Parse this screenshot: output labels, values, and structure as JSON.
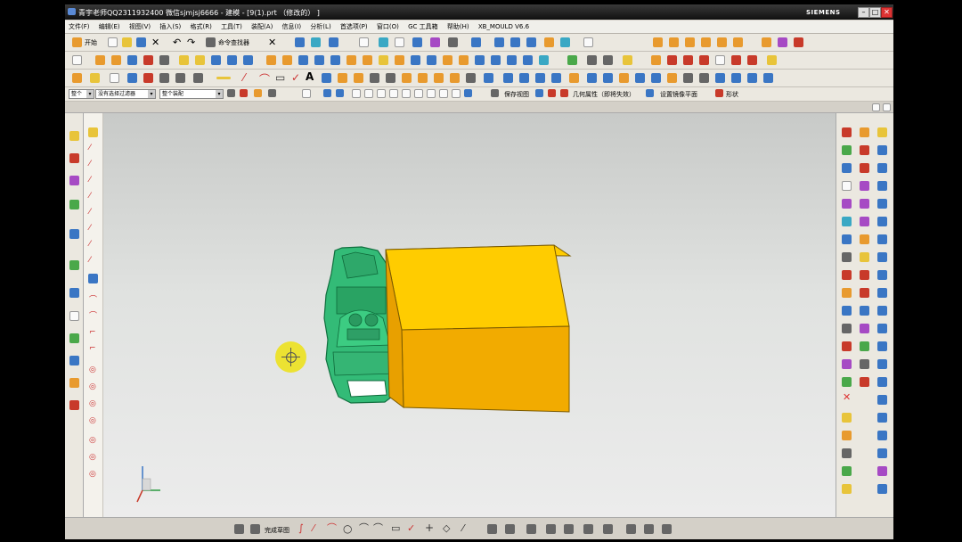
{
  "window": {
    "title": "青宇老师QQ2311932400 微信sjmjsj6666 - 建模 - [9(1).prt （修改的） ]",
    "brand": "SIEMENS",
    "buttons": {
      "minimize": "–",
      "restore": "□",
      "close": "✕"
    }
  },
  "menu": [
    "文件(F)",
    "编辑(E)",
    "视图(V)",
    "插入(S)",
    "格式(R)",
    "工具(T)",
    "装配(A)",
    "信息(I)",
    "分析(L)",
    "首选项(P)",
    "窗口(O)",
    "GC 工具箱",
    "帮助(H)",
    "XB_MOULD V6.6"
  ],
  "toolbar1": {
    "start_label": "开始",
    "command_finder_label": "命令查找器"
  },
  "toolbar4": {
    "filter_type": "整个",
    "filter_selection": "没有选择过滤器",
    "assembly_scope": "整个装配",
    "save_view_label": "保存视图",
    "geometry_label": "几何属性（即将失效）",
    "view_plane_label": "设置镜像平面",
    "shape_label": "形状"
  },
  "bottom": {
    "sketch_label": "完成草图"
  },
  "colors": {
    "box_top": "#ffcc00",
    "box_front": "#f2ab00",
    "part": "#33bb77",
    "cursor": "#ece228"
  }
}
